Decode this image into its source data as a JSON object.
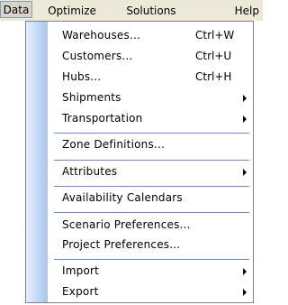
{
  "menubar": {
    "items": [
      "Data",
      "Optimize",
      "Solutions",
      "Help"
    ]
  },
  "menu": {
    "items": [
      {
        "label": "Warehouses...",
        "shortcut": "Ctrl+W"
      },
      {
        "label": "Customers...",
        "shortcut": "Ctrl+U"
      },
      {
        "label": "Hubs...",
        "shortcut": "Ctrl+H"
      },
      {
        "label": "Shipments",
        "submenu": true
      },
      {
        "label": "Transportation",
        "submenu": true
      },
      {
        "label": "Zone Definitions..."
      },
      {
        "label": "Attributes",
        "submenu": true
      },
      {
        "label": "Availability Calendars"
      },
      {
        "label": "Scenario Preferences..."
      },
      {
        "label": "Project Preferences..."
      },
      {
        "label": "Import",
        "submenu": true
      },
      {
        "label": "Export",
        "submenu": true
      }
    ]
  },
  "colors": {
    "menubar_bg": "#ece9d8",
    "gutter_start": "#e6efff",
    "gutter_end": "#a7c4ec",
    "separator": "#6a8bc8"
  }
}
